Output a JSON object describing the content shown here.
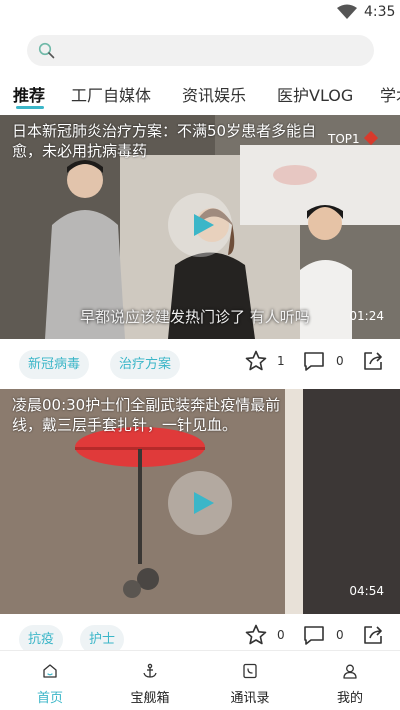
{
  "status_bar": {
    "time": "4:35",
    "wifi_icon": "wifi-icon"
  },
  "search": {
    "placeholder": "",
    "icon": "search-icon"
  },
  "tabs": [
    {
      "label": "推荐",
      "active": true
    },
    {
      "label": "工厂自媒体",
      "active": false
    },
    {
      "label": "资讯娱乐",
      "active": false
    },
    {
      "label": "医护VLOG",
      "active": false
    },
    {
      "label": "学术",
      "active": false
    }
  ],
  "feed": [
    {
      "title": "日本新冠肺炎治疗方案：不满50岁患者多能自愈，未必用抗病毒药",
      "badge": "TOP1",
      "subtitle": "早都说应该建发热门诊了 有人听吗",
      "duration": "01:24",
      "tags": [
        "新冠病毒",
        "治疗方案"
      ],
      "likes": "1",
      "comments": "0"
    },
    {
      "title": "凌晨00:30护士们全副武装奔赴疫情最前线，戴三层手套扎针，一针见血。",
      "duration": "04:54",
      "tags": [
        "抗疫",
        "护士"
      ],
      "likes": "0",
      "comments": "0"
    }
  ],
  "bottom_nav": [
    {
      "label": "首页",
      "icon": "home-icon",
      "active": true
    },
    {
      "label": "宝舰箱",
      "icon": "anchor-icon",
      "active": false
    },
    {
      "label": "通讯录",
      "icon": "contacts-icon",
      "active": false
    },
    {
      "label": "我的",
      "icon": "user-icon",
      "active": false
    }
  ],
  "colors": {
    "accent": "#3bb6c8",
    "tag_bg": "#eef3f5",
    "badge_leaf": "#d83a2c"
  }
}
